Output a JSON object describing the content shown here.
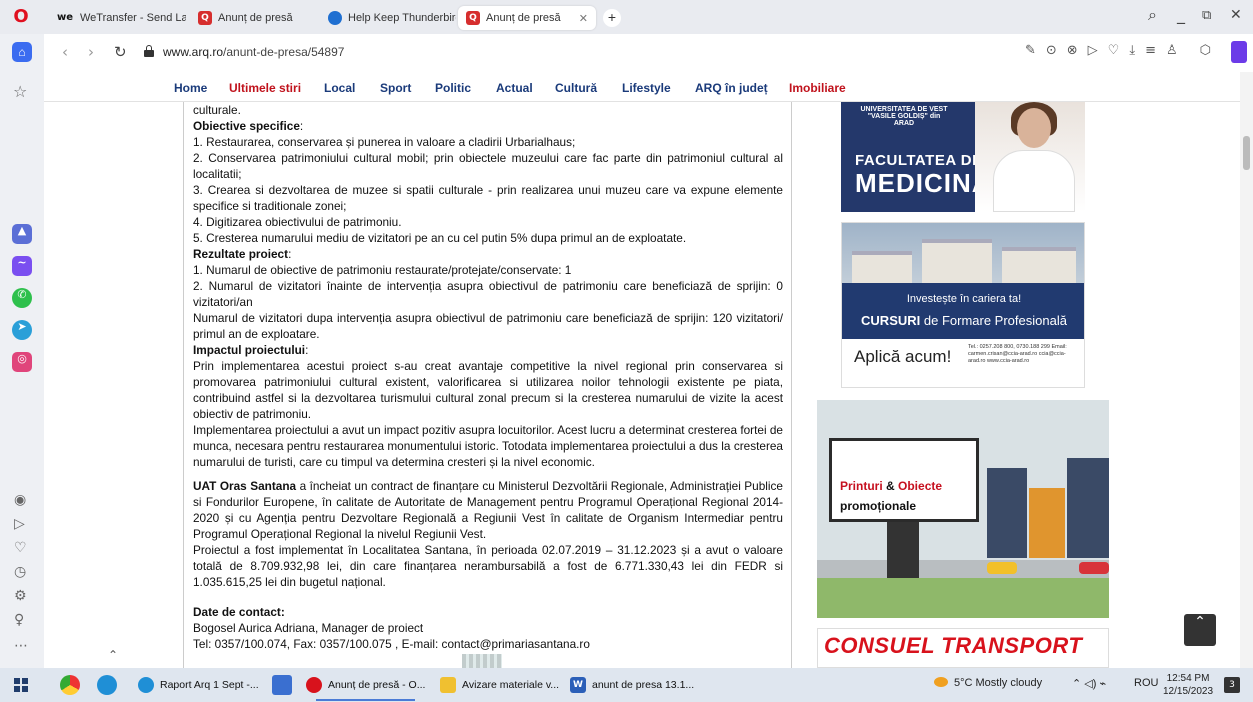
{
  "browser": {
    "tabs": [
      {
        "label": "WeTransfer - Send Large F",
        "favicon": "wetransfer-icon"
      },
      {
        "label": "Anunț de presă",
        "favicon": "q-icon"
      },
      {
        "label": "Help Keep Thunderbird Al",
        "favicon": "thunderbird-icon"
      },
      {
        "label": "Anunț de presă",
        "favicon": "q-icon",
        "active": true
      }
    ],
    "new_tab": "+",
    "url_host": "www.arq.ro",
    "url_path": "/anunt-de-presa/54897",
    "win_min": "_",
    "win_restore": "⧉",
    "win_close": "✕",
    "search_glyph": "🔍"
  },
  "site_nav": {
    "items": [
      {
        "label": "Home",
        "color": "#1a3a7a"
      },
      {
        "label": "Ultimele stiri",
        "color": "#c0121c"
      },
      {
        "label": "Local",
        "color": "#1a3a7a"
      },
      {
        "label": "Sport",
        "color": "#1a3a7a"
      },
      {
        "label": "Politic",
        "color": "#1a3a7a"
      },
      {
        "label": "Actual",
        "color": "#1a3a7a"
      },
      {
        "label": "Cultură",
        "color": "#1a3a7a"
      },
      {
        "label": "Lifestyle",
        "color": "#1a3a7a"
      },
      {
        "label": "ARQ în județ",
        "color": "#1a3a7a"
      },
      {
        "label": "Imobiliare",
        "color": "#c0121c"
      }
    ]
  },
  "article": {
    "intro_tail": "culturale.",
    "obj_heading": "Obiective specifice",
    "objectives": [
      "1. Restaurarea, conservarea și punerea in valoare a cladirii Urbarialhaus;",
      "2. Conservarea patrimoniului cultural mobil; prin obiectele muzeului care fac parte din patrimoniul cultural al localitatii;",
      "3. Crearea si dezvoltarea de muzee si spatii culturale - prin realizarea unui muzeu care va expune elemente specifice si traditionale zonei;",
      "4. Digitizarea obiectivului de patrimoniu.",
      "5. Cresterea numarului mediu de vizitatori pe an cu cel putin 5% dupa primul an de exploatate."
    ],
    "res_heading": "Rezultate proiect",
    "results": [
      "1. Numarul de obiective de patrimoniu restaurate/protejate/conservate: 1",
      "2. Numarul de vizitatori înainte de intervenția asupra obiectivul de patrimoniu care beneficiază de sprijin: 0 vizitatori/an",
      "Numarul de vizitatori dupa intervenția asupra obiectivul de patrimoniu care beneficiază de sprijin: 120 vizitatori/ primul an de exploatare."
    ],
    "impact_heading": "Impactul proiectului",
    "impact": [
      " Prin implementarea acestui proiect s-au creat avantaje competitive la nivel regional prin conservarea si promovarea patrimoniului cultural existent, valorificarea si utilizarea noilor tehnologii existente pe piata, contribuind astfel si la dezvoltarea turismului cultural zonal precum si la cresterea numarului de vizite la acest obiectiv de patrimoniu.",
      "Implementarea proiectului a avut un impact pozitiv asupra locuitorilor. Acest lucru a determinat cresterea fortei de munca, necesara pentru restaurarea monumentului istoric. Totodata implementarea proiectului a dus la cresterea numarului de turisti, care cu timpul va determina cresteri și la nivel economic."
    ],
    "uat_bold": "UAT Oras Santana",
    "uat_text": " a încheiat un contract de finanțare cu Ministerul Dezvoltării Regionale, Administrației Publice si Fondurilor Europene, în calitate de Autoritate de Management pentru Programul Operațional Regional 2014-2020 și cu Agenția pentru Dezvoltare Regională a Regiunii Vest în calitate de Organism Intermediar pentru Programul Operațional Regional la nivelul Regiunii Vest.",
    "implemented": "Proiectul a fost implementat în Localitatea Santana, în perioada 02.07.2019 – 31.12.2023 și a avut o valoare totală de 8.709.932,98 lei, din care finanțarea nerambursabilă a fost de 6.771.330,43 lei din FEDR si 1.035.615,25 lei din bugetul național.",
    "contact_heading": "Date de contact:",
    "contact_name": "Bogosel Aurica Adriana, Manager de proiect",
    "contact_line": "Tel: 0357/100.074, Fax: 0357/100.075 , E-mail: contact@primariasantana.ro"
  },
  "ads": {
    "med": {
      "university": "UNIVERSITATEA DE VEST \"VASILE GOLDIȘ\" din ARAD",
      "line1": "FACULTATEA DE",
      "line2": "MEDICINĂ"
    },
    "ccia": {
      "invest": "Investește în cariera ta!",
      "courses_bold": "CURSURI",
      "courses_rest": " de Formare Profesională",
      "apply": "Aplică acum!",
      "contact": "Tel.: 0257.208 800, 0730.188 299 Email: carmen.crisan@ccia-arad.ro ccia@ccia-arad.ro www.ccia-arad.ro"
    },
    "print": {
      "line1": "Printuri",
      "amp": " & ",
      "line1b": "Obiecte",
      "line2": "promoționale"
    },
    "consuel": "CONSUEL TRANSPORT"
  },
  "taskbar": {
    "apps": [
      {
        "label": "Raport Arq 1 Sept -..."
      },
      {
        "label": "Anunț de presă - O...",
        "active": true
      },
      {
        "label": "Avizare materiale v..."
      },
      {
        "label": "anunt de presa 13.1..."
      }
    ],
    "weather": "5°C  Mostly cloudy",
    "lang": "ROU",
    "time": "12:54 PM",
    "date": "12/15/2023",
    "notif_count": "3"
  },
  "colors": {
    "accent": "#6c3be8",
    "nav_blue": "#1a3a7a",
    "nav_red": "#c0121c"
  }
}
